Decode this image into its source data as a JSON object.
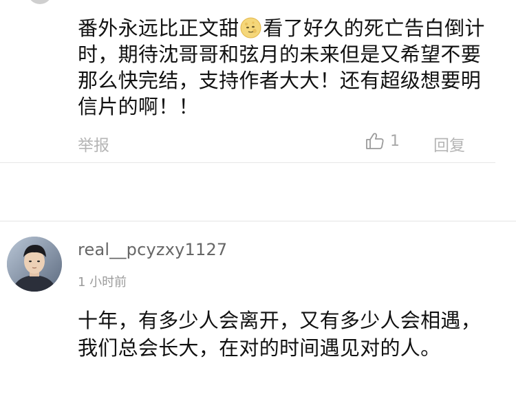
{
  "comments": [
    {
      "text_part1": "番外永远比正文甜",
      "emoji": "moon-face-emoji",
      "text_part2": "看了好久的死亡告白倒计时，期待沈哥哥和弦月的未来但是又希望不要那么快完结，支持作者大大！还有超级想要明信片的啊！！",
      "report_label": "举报",
      "like_icon": "thumbs-up-outline-icon",
      "like_count": "1",
      "reply_label": "回复"
    },
    {
      "username": "real__pcyzxy1127",
      "timestamp": "1 小时前",
      "text": "十年，有多少人会离开，又有多少人会相遇，我们总会长大，在对的时间遇见对的人。"
    }
  ],
  "colors": {
    "text_primary": "#111111",
    "text_muted": "#b5b5b5",
    "username": "#666666",
    "divider": "#e6e6e6",
    "emoji_fill": "#f5d77a"
  }
}
